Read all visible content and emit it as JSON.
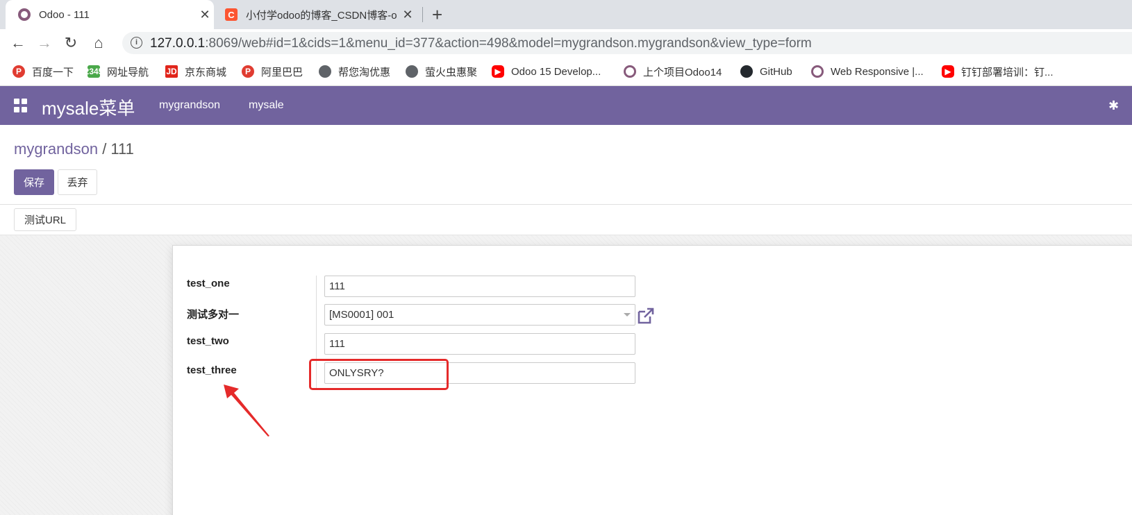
{
  "browser": {
    "tabs": [
      {
        "title": "Odoo - 111",
        "active": true
      },
      {
        "title": "小付学odoo的博客_CSDN博客-o",
        "active": false
      }
    ],
    "url": {
      "host": "127.0.0.1",
      "rest": ":8069/web#id=1&cids=1&menu_id=377&action=498&model=mygrandson.mygrandson&view_type=form"
    },
    "bookmarks": [
      {
        "label": "百度一下",
        "icon": "red-p-icon"
      },
      {
        "label": "网址导航",
        "icon": "2345-icon"
      },
      {
        "label": "京东商城",
        "icon": "jd-icon"
      },
      {
        "label": "阿里巴巴",
        "icon": "red-p-icon"
      },
      {
        "label": "帮您淘优惠",
        "icon": "globe-icon"
      },
      {
        "label": "萤火虫惠聚",
        "icon": "globe-icon"
      },
      {
        "label": "Odoo 15 Develop...",
        "icon": "youtube-icon"
      },
      {
        "label": "上个项目Odoo14",
        "icon": "odoo-icon"
      },
      {
        "label": "GitHub",
        "icon": "github-icon"
      },
      {
        "label": "Web Responsive |...",
        "icon": "odoo-icon"
      },
      {
        "label": "钉钉部署培训：钉...",
        "icon": "youtube-icon"
      }
    ]
  },
  "odoo": {
    "brand": "mysale菜单",
    "menu": [
      "mygrandson",
      "mysale"
    ],
    "accent": "#71639e"
  },
  "breadcrumb": {
    "parent": "mygrandson",
    "separator": " / ",
    "current": "111"
  },
  "buttons": {
    "save": "保存",
    "discard": "丢弃",
    "test_url": "测试URL"
  },
  "form": {
    "fields": [
      {
        "label": "test_one",
        "value": "111"
      },
      {
        "label": "测试多对一",
        "value": "[MS0001] 001"
      },
      {
        "label": "test_two",
        "value": "111"
      },
      {
        "label": "test_three",
        "value": "ONLYSRY?"
      }
    ]
  },
  "annotation": {
    "highlight_color": "#e52a2a"
  }
}
